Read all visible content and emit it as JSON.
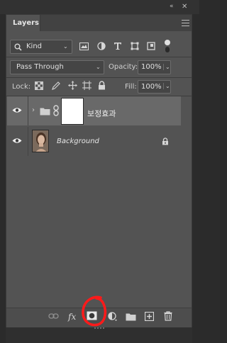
{
  "panel": {
    "tab_title": "Layers",
    "collapse_glyph": "«",
    "close_glyph": "✕"
  },
  "filter": {
    "kind_label": "Kind",
    "icons": [
      "pixel-filter-icon",
      "adjustment-filter-icon",
      "type-filter-icon",
      "shape-filter-icon",
      "smart-object-filter-icon",
      "filter-toggle-icon"
    ]
  },
  "blend": {
    "mode": "Pass Through",
    "opacity_label": "Opacity:",
    "opacity_value": "100%"
  },
  "lock": {
    "label": "Lock:",
    "fill_label": "Fill:",
    "fill_value": "100%",
    "icons": [
      "lock-transparent-pixels-icon",
      "lock-image-pixels-icon",
      "lock-position-icon",
      "lock-artboard-icon",
      "lock-all-icon"
    ]
  },
  "layers": [
    {
      "name": "보정효과",
      "type": "group",
      "selected": true,
      "visible": true,
      "has_mask": true
    },
    {
      "name": "Background",
      "type": "image",
      "selected": false,
      "visible": true,
      "locked": true
    }
  ],
  "bottom_icons": [
    "link-layers-icon",
    "fx-icon",
    "add-mask-icon",
    "adjustment-layer-icon",
    "new-group-icon",
    "new-layer-icon",
    "delete-layer-icon"
  ],
  "bottom_fx_label": "fx",
  "colors": {
    "panel_bg": "#535353",
    "selected_layer": "#696969",
    "annotation_red": "#ff1a1a"
  }
}
